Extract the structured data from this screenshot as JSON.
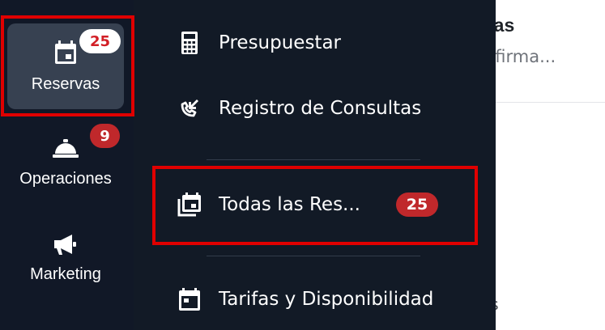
{
  "background": {
    "title_fragment": "tas",
    "subtitle_fragment": "nfirma...",
    "bottom_fragment": "as"
  },
  "rail": {
    "items": [
      {
        "label": "Reservas",
        "icon": "calendar-icon",
        "badge": "25",
        "active": true
      },
      {
        "label": "Operaciones",
        "icon": "service-bell-icon",
        "badge": "9",
        "active": false
      },
      {
        "label": "Marketing",
        "icon": "megaphone-icon",
        "badge": null,
        "active": false
      }
    ]
  },
  "menu": {
    "items": [
      {
        "label": "Presupuestar",
        "icon": "calculator-icon"
      },
      {
        "label": "Registro de Consultas",
        "icon": "incoming-call-icon"
      },
      {
        "label": "Todas las Res...",
        "icon": "calendar-multiple-icon",
        "badge": "25"
      },
      {
        "label": "Tarifas y Disponibilidad",
        "icon": "calendar-today-icon"
      }
    ]
  },
  "colors": {
    "rail_bg": "#111827",
    "rail_active_bg": "#374151",
    "flyout_bg": "#121a26",
    "badge_red": "#c0282b",
    "highlight": "#e00000"
  }
}
